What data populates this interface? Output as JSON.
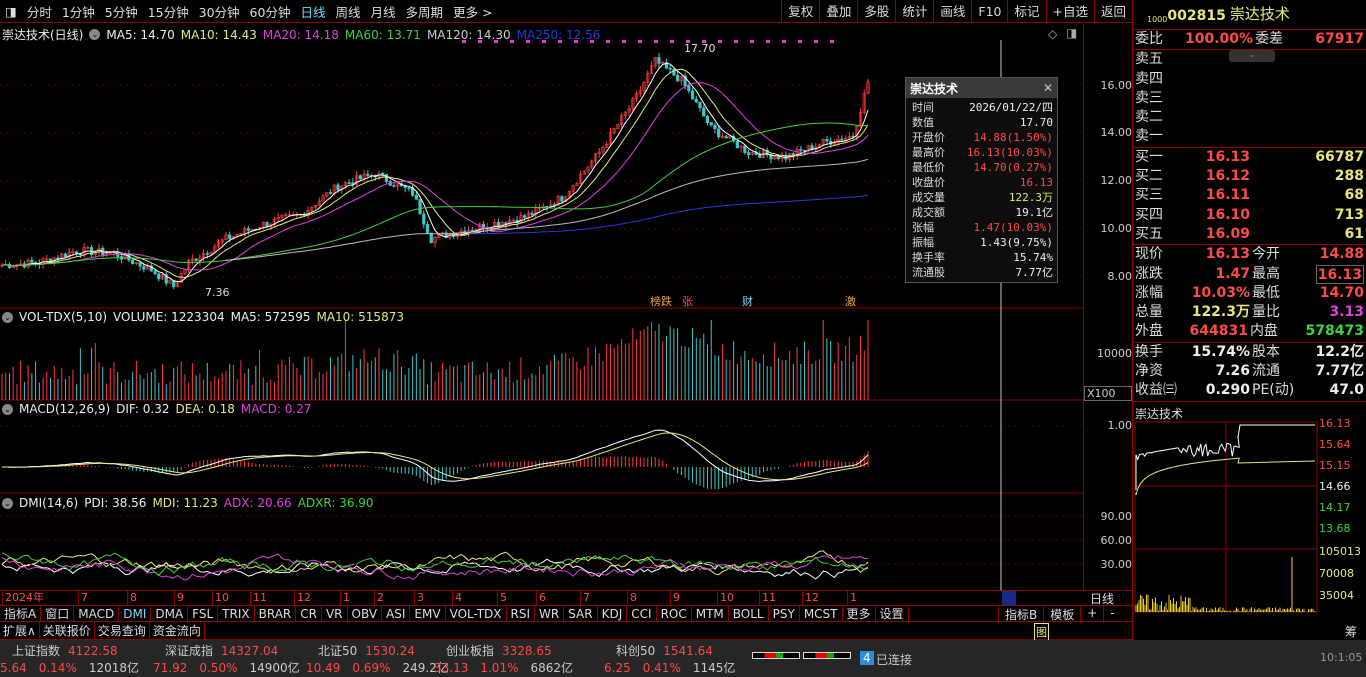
{
  "toolbar": {
    "periods": [
      "分时",
      "1分钟",
      "5分钟",
      "15分钟",
      "30分钟",
      "60分钟",
      "日线",
      "周线",
      "月线",
      "多周期",
      "更多 >"
    ],
    "active": "日线",
    "actions": [
      "复权",
      "叠加",
      "多股",
      "统计",
      "画线",
      "F10",
      "标记",
      "+自选",
      "返回"
    ]
  },
  "main_legend": {
    "title": "崇达技术(日线)",
    "ma5": "MA5: 14.70",
    "ma10": "MA10: 14.43",
    "ma20": "MA20: 14.18",
    "ma60": "MA60: 13.71",
    "ma120": "MA120: 14.30",
    "ma250": "MA250: 12.56"
  },
  "price_axis": [
    "16.00",
    "14.00",
    "12.00",
    "10.00",
    "8.00"
  ],
  "annotations": {
    "high": "17.70",
    "low": "7.36",
    "marks": [
      "榜跌",
      "张",
      "财",
      "激"
    ]
  },
  "vol_legend": {
    "name": "VOL-TDX(5,10)",
    "volume": "VOLUME: 1223304",
    "ma5": "MA5: 572595",
    "ma10": "MA10: 515873",
    "axis": "10000",
    "unit": "X100"
  },
  "macd_legend": {
    "name": "MACD(12,26,9)",
    "dif": "DIF: 0.32",
    "dea": "DEA: 0.18",
    "macd": "MACD: 0.27",
    "axis": "1.00"
  },
  "dmi_legend": {
    "name": "DMI(14,6)",
    "pdi": "PDI: 38.56",
    "mdi": "MDI: 11.23",
    "adx": "ADX: 20.66",
    "adxr": "ADXR: 36.90",
    "axis": [
      "90.00",
      "60.00",
      "30.00"
    ]
  },
  "x_axis": [
    "2024年",
    "7",
    "8",
    "9",
    "10",
    "11",
    "12",
    "1",
    "2",
    "3",
    "4",
    "5",
    "6",
    "7",
    "8",
    "9",
    "10",
    "11",
    "12",
    "1"
  ],
  "period_label": "日线",
  "popup": {
    "title": "崇达技术",
    "rows": [
      [
        "时间",
        "2026/01/22/四"
      ],
      [
        "数值",
        "17.70"
      ],
      [
        "开盘价",
        "14.88(1.50%)"
      ],
      [
        "最高价",
        "16.13(10.03%)"
      ],
      [
        "最低价",
        "14.70(0.27%)"
      ],
      [
        "收盘价",
        "16.13"
      ],
      [
        "成交量",
        "122.3万"
      ],
      [
        "成交额",
        "19.1亿"
      ],
      [
        "张幅",
        "1.47(10.03%)"
      ],
      [
        "振幅",
        "1.43(9.75%)"
      ],
      [
        "换手率",
        "15.74%"
      ],
      [
        "流通股",
        "7.77亿"
      ]
    ]
  },
  "quote": {
    "code": "002815",
    "name": "崇达技术",
    "tag": "1000",
    "weibi_label": "委比",
    "weibi": "100.00%",
    "weicha_label": "委差",
    "weicha": "67917",
    "sell": [
      "卖五",
      "卖四",
      "卖三",
      "卖二",
      "卖一"
    ],
    "buy": [
      [
        "买一",
        "16.13",
        "66787"
      ],
      [
        "买二",
        "16.12",
        "288"
      ],
      [
        "买三",
        "16.11",
        "68"
      ],
      [
        "买四",
        "16.10",
        "713"
      ],
      [
        "买五",
        "16.09",
        "61"
      ]
    ],
    "stats": [
      [
        "现价",
        "16.13",
        "今开",
        "14.88"
      ],
      [
        "涨跌",
        "1.47",
        "最高",
        "16.13"
      ],
      [
        "涨幅",
        "10.03%",
        "最低",
        "14.70"
      ],
      [
        "总量",
        "122.3万",
        "量比",
        "3.13"
      ],
      [
        "外盘",
        "644831",
        "内盘",
        "578473"
      ]
    ],
    "fund": [
      [
        "换手",
        "15.74%",
        "股本",
        "12.2亿"
      ],
      [
        "净资",
        "7.26",
        "流通",
        "7.77亿"
      ],
      [
        "收益㈢",
        "0.290",
        "PE(动)",
        "47.0"
      ]
    ]
  },
  "mini": {
    "title": "崇达技术",
    "price_axis": [
      "16.13",
      "15.64",
      "15.15",
      "14.66",
      "14.17",
      "13.68"
    ],
    "vol_axis": [
      "105013",
      "70008",
      "35004"
    ]
  },
  "indicator_tabs": [
    "指标A",
    "窗口",
    "MACD",
    "DMI",
    "DMA",
    "FSL",
    "TRIX",
    "BRAR",
    "CR",
    "VR",
    "OBV",
    "ASI",
    "EMV",
    "VOL-TDX",
    "RSI",
    "WR",
    "SAR",
    "KDJ",
    "CCI",
    "ROC",
    "MTM",
    "BOLL",
    "PSY",
    "MCST",
    "更多",
    "设置"
  ],
  "indicator_right": [
    "指标B",
    "模板",
    "+",
    "-"
  ],
  "bottom_tabs": [
    "扩展∧",
    "关联报价",
    "交易查询",
    "资金流向"
  ],
  "chart_tab": "图",
  "chip_tab": "筹",
  "indices": [
    {
      "name": "上证指数",
      "value": "4122.58",
      "chg": "5.64",
      "pct": "0.14%",
      "amt": "12018亿"
    },
    {
      "name": "深证成指",
      "value": "14327.04",
      "chg": "71.92",
      "pct": "0.50%",
      "amt": "14900亿"
    },
    {
      "name": "北证50",
      "value": "1530.24",
      "chg": "10.49",
      "pct": "0.69%",
      "amt": "249.2亿"
    },
    {
      "name": "创业板指",
      "value": "3328.65",
      "chg": "33.13",
      "pct": "1.01%",
      "amt": "6862亿"
    },
    {
      "name": "科创50",
      "value": "1541.64",
      "chg": "6.25",
      "pct": "0.41%",
      "amt": "1145亿"
    }
  ],
  "connection": {
    "count": "4",
    "label": "已连接"
  },
  "clock": "10:1:05",
  "chart_data": {
    "type": "line",
    "close_keypoints": [
      [
        0,
        8.5
      ],
      [
        10,
        8.6
      ],
      [
        20,
        9.1
      ],
      [
        30,
        9.0
      ],
      [
        40,
        8.3
      ],
      [
        46,
        7.6
      ],
      [
        50,
        8.6
      ],
      [
        60,
        9.6
      ],
      [
        70,
        10.2
      ],
      [
        80,
        10.6
      ],
      [
        90,
        11.8
      ],
      [
        100,
        12.3
      ],
      [
        110,
        11.5
      ],
      [
        115,
        9.6
      ],
      [
        125,
        10.0
      ],
      [
        140,
        10.5
      ],
      [
        150,
        11.3
      ],
      [
        160,
        13.2
      ],
      [
        170,
        15.5
      ],
      [
        175,
        17.0
      ],
      [
        182,
        16.2
      ],
      [
        190,
        14.2
      ],
      [
        200,
        13.2
      ],
      [
        210,
        13.0
      ],
      [
        220,
        13.6
      ],
      [
        228,
        13.9
      ],
      [
        232,
        16.13
      ]
    ]
  }
}
